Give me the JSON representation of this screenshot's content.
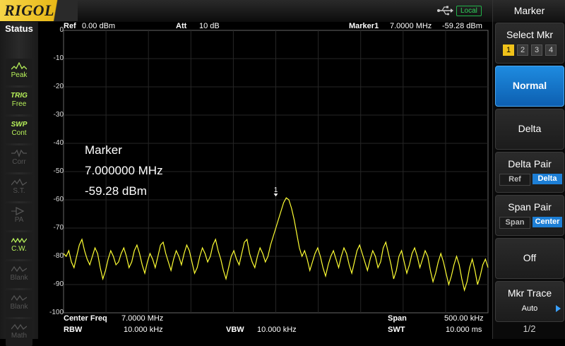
{
  "brand": "RIGOL",
  "topbar": {
    "remote_state": "Local",
    "usb_icon": "usb-icon"
  },
  "status": {
    "title": "Status",
    "items": [
      {
        "sym": "",
        "label": "Peak",
        "state": "on",
        "icon": "peak-wave-icon"
      },
      {
        "sym": "TRIG",
        "label": "Free",
        "state": "on",
        "icon": ""
      },
      {
        "sym": "SWP",
        "label": "Cont",
        "state": "on",
        "icon": ""
      },
      {
        "sym": "",
        "label": "Corr",
        "state": "off",
        "icon": "corr-icon"
      },
      {
        "sym": "",
        "label": "S.T.",
        "state": "off",
        "icon": "st-icon"
      },
      {
        "sym": "",
        "label": "PA",
        "state": "off",
        "icon": "pa-icon"
      },
      {
        "sym": "",
        "label": "C.W.",
        "state": "on",
        "icon": "cw-icon"
      },
      {
        "sym": "",
        "label": "Blank",
        "state": "off",
        "icon": "blank-icon"
      },
      {
        "sym": "",
        "label": "Blank",
        "state": "off",
        "icon": "blank-icon"
      },
      {
        "sym": "",
        "label": "Math",
        "state": "off",
        "icon": "math-icon"
      }
    ]
  },
  "header": {
    "ref_label": "Ref",
    "ref_value": "0.00 dBm",
    "att_label": "Att",
    "att_value": "10 dB",
    "marker_label": "Marker1",
    "marker_freq": "7.0000 MHz",
    "marker_level": "-59.28 dBm"
  },
  "y_ticks": [
    "0",
    "-10",
    "-20",
    "-30",
    "-40",
    "-50",
    "-60",
    "-70",
    "-80",
    "-90",
    "-100"
  ],
  "marker_readout": {
    "title": "Marker",
    "freq": "7.000000 MHz",
    "level": "-59.28 dBm",
    "tag": "1"
  },
  "footer": {
    "center_freq_label": "Center Freq",
    "center_freq_value": "7.0000 MHz",
    "span_label": "Span",
    "span_value": "500.00 kHz",
    "rbw_label": "RBW",
    "rbw_value": "10.000 kHz",
    "vbw_label": "VBW",
    "vbw_value": "10.000 kHz",
    "swt_label": "SWT",
    "swt_value": "10.000 ms"
  },
  "menu": {
    "title": "Marker",
    "select_mkr_label": "Select Mkr",
    "markers": [
      "1",
      "2",
      "3",
      "4"
    ],
    "normal_label": "Normal",
    "delta_label": "Delta",
    "delta_pair_label": "Delta Pair",
    "delta_pair_options": [
      "Ref",
      "Delta"
    ],
    "span_pair_label": "Span Pair",
    "span_pair_options": [
      "Span",
      "Center"
    ],
    "off_label": "Off",
    "mkr_trace_label": "Mkr Trace",
    "mkr_trace_value": "Auto",
    "page": "1/2"
  },
  "trace": {
    "color": "#ffff33",
    "start_freq_mhz": 6.75,
    "stop_freq_mhz": 7.25,
    "ref_level_dbm": 0,
    "bottom_level_dbm": -100,
    "peak_freq_mhz": 7.0,
    "peak_level_dbm": -59.28,
    "points_dbm": [
      -79,
      -80,
      -78,
      -82,
      -84,
      -80,
      -76,
      -74,
      -78,
      -81,
      -83,
      -80,
      -77,
      -79,
      -84,
      -88,
      -85,
      -81,
      -78,
      -80,
      -83,
      -82,
      -79,
      -77,
      -80,
      -84,
      -82,
      -78,
      -76,
      -79,
      -83,
      -86,
      -82,
      -79,
      -81,
      -84,
      -80,
      -76,
      -75,
      -79,
      -82,
      -85,
      -81,
      -78,
      -80,
      -83,
      -79,
      -76,
      -78,
      -82,
      -86,
      -84,
      -80,
      -77,
      -79,
      -82,
      -80,
      -76,
      -74,
      -78,
      -81,
      -85,
      -88,
      -84,
      -80,
      -78,
      -81,
      -83,
      -79,
      -75,
      -74,
      -79,
      -82,
      -84,
      -80,
      -77,
      -79,
      -82,
      -80,
      -76,
      -73,
      -70,
      -67,
      -64,
      -61,
      -59.3,
      -60,
      -63,
      -67,
      -72,
      -77,
      -80,
      -78,
      -81,
      -85,
      -82,
      -79,
      -77,
      -80,
      -84,
      -87,
      -83,
      -80,
      -78,
      -81,
      -84,
      -80,
      -77,
      -79,
      -83,
      -86,
      -82,
      -78,
      -76,
      -79,
      -82,
      -85,
      -81,
      -78,
      -80,
      -84,
      -82,
      -77,
      -75,
      -79,
      -83,
      -88,
      -85,
      -80,
      -78,
      -82,
      -86,
      -83,
      -79,
      -77,
      -80,
      -84,
      -81,
      -78,
      -80,
      -85,
      -89,
      -86,
      -82,
      -79,
      -82,
      -86,
      -90,
      -87,
      -83,
      -80,
      -83,
      -88,
      -92,
      -89,
      -84,
      -81,
      -85,
      -90,
      -87,
      -83,
      -81,
      -84
    ]
  }
}
